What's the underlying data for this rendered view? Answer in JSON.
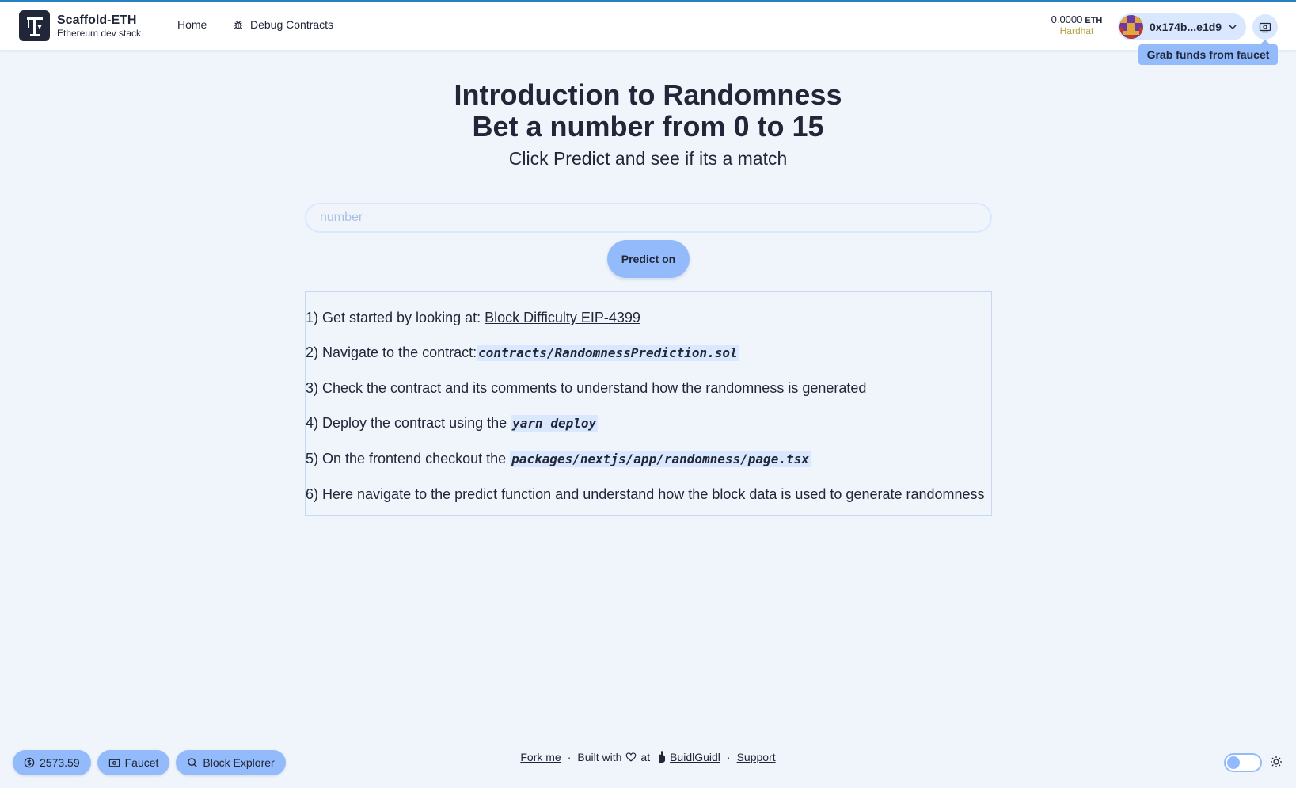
{
  "header": {
    "brand_title": "Scaffold-ETH",
    "brand_subtitle": "Ethereum dev stack",
    "nav": {
      "home": "Home",
      "debug": "Debug Contracts"
    },
    "balance": {
      "value": "0.0000",
      "unit": "ETH",
      "network": "Hardhat"
    },
    "account": {
      "address": "0x174b...e1d9"
    },
    "tooltip": "Grab funds from faucet"
  },
  "main": {
    "title_line1": "Introduction to Randomness",
    "title_line2": "Bet a number from 0 to 15",
    "subtitle": "Click Predict and see if its a match",
    "input_placeholder": "number",
    "predict_label": "Predict on"
  },
  "steps": {
    "s1_text": "1) Get started by looking at: ",
    "s1_link": "Block Difficulty EIP-4399",
    "s2_text": "2) Navigate to the contract:",
    "s2_code": "contracts/RandomnessPrediction.sol",
    "s3_text": "3) Check the contract and its comments to understand how the randomness is generated",
    "s4_text": "4) Deploy the contract using the ",
    "s4_code": "yarn deploy",
    "s5_text": "5) On the frontend checkout the ",
    "s5_code": "packages/nextjs/app/randomness/page.tsx",
    "s6_text": "6) Here navigate to the predict function and understand how the block data is used to generate randomness"
  },
  "footer": {
    "eth_price": "2573.59",
    "faucet": "Faucet",
    "block_explorer": "Block Explorer",
    "fork_me": "Fork me",
    "built_with": "Built with",
    "at": "at",
    "buidlguidl": "BuidlGuidl",
    "support": "Support"
  },
  "colors": {
    "accent": "#93bbfb",
    "accent_light": "#dae8ff",
    "background": "#f0f5fc",
    "text": "#212638",
    "network": "#b8a23a"
  }
}
